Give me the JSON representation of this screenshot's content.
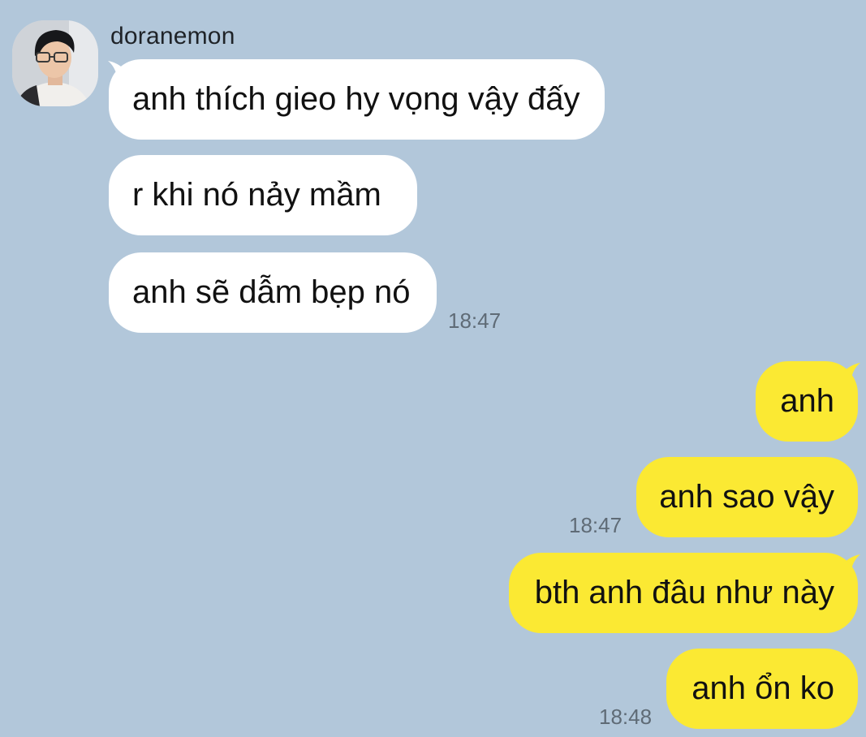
{
  "chat": {
    "sender_name": "doranemon",
    "avatar_icon": "profile-photo",
    "colors": {
      "background": "#b2c7da",
      "incoming_bubble": "#ffffff",
      "outgoing_bubble": "#fbe933",
      "timestamp": "#5f6b76"
    },
    "incoming": [
      {
        "text": "anh thích gieo hy vọng vậy đấy"
      },
      {
        "text": "r khi nó nảy mầm"
      },
      {
        "text": "anh sẽ dẫm bẹp nó"
      }
    ],
    "incoming_time": "18:47",
    "outgoing": [
      {
        "text": "anh"
      },
      {
        "text": "anh sao vậy"
      },
      {
        "text": "bth anh đâu như này"
      },
      {
        "text": "anh ổn ko"
      }
    ],
    "outgoing_times": [
      "18:47",
      "18:48"
    ]
  }
}
